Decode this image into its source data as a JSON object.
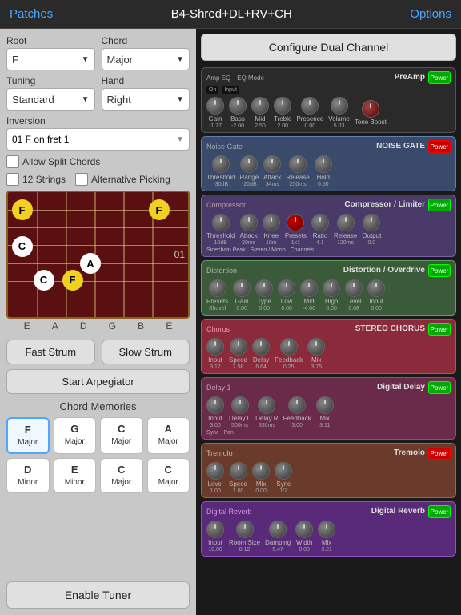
{
  "topbar": {
    "patches": "Patches",
    "title": "B4-Shred+DL+RV+CH",
    "options": "Options"
  },
  "left": {
    "root_label": "Root",
    "root_value": "F",
    "chord_label": "Chord",
    "chord_value": "Major",
    "tuning_label": "Tuning",
    "tuning_value": "Standard",
    "hand_label": "Hand",
    "hand_value": "Right",
    "inversion_label": "Inversion",
    "inversion_value": "01 F on fret 1",
    "allow_split": "Allow Split Chords",
    "twelve_strings": "12 Strings",
    "alt_picking": "Alternative Picking",
    "fret_number": "01",
    "string_labels": [
      "E",
      "A",
      "D",
      "G",
      "B",
      "E"
    ],
    "fast_strum": "Fast Strum",
    "slow_strum": "Slow Strum",
    "start_arp": "Start Arpegiator",
    "chord_memories_label": "Chord Memories",
    "chords": [
      {
        "root": "F",
        "type": "Major",
        "selected": true
      },
      {
        "root": "G",
        "type": "Major",
        "selected": false
      },
      {
        "root": "C",
        "type": "Major",
        "selected": false
      },
      {
        "root": "A",
        "type": "Major",
        "selected": false
      },
      {
        "root": "D",
        "type": "Minor",
        "selected": false
      },
      {
        "root": "E",
        "type": "Minor",
        "selected": false
      },
      {
        "root": "C",
        "type": "Major",
        "selected": false
      },
      {
        "root": "C",
        "type": "Major",
        "selected": false
      }
    ],
    "enable_tuner": "Enable Tuner"
  },
  "right": {
    "configure_btn": "Configure Dual Channel",
    "modules": [
      {
        "id": "preamp",
        "label_left": "Preamp",
        "title": "PreAmp",
        "knobs": [
          {
            "label": "Gain",
            "value": "-1.77"
          },
          {
            "label": "Bass",
            "value": "-2.00"
          },
          {
            "label": "Mid",
            "value": "2.50"
          },
          {
            "label": "Treble",
            "value": "2.00"
          },
          {
            "label": "Presence",
            "value": "0.00"
          },
          {
            "label": "Volume",
            "value": "5.03"
          }
        ],
        "extra": "Tone Boost",
        "sub_labels": [
          "Amp EQ",
          "EQ Mode"
        ],
        "sub_values": [
          "On",
          "Input"
        ],
        "power": "Power"
      },
      {
        "id": "noisegate",
        "label_left": "Noise Gate",
        "title": "NOISE GATE",
        "knobs": [
          {
            "label": "Threshold",
            "value": "-30dB"
          },
          {
            "label": "Range",
            "value": "-20dB"
          },
          {
            "label": "Attack",
            "value": "34ms"
          },
          {
            "label": "Release",
            "value": "250ms"
          },
          {
            "label": "Hold",
            "value": "0.50"
          }
        ],
        "power": "Power"
      },
      {
        "id": "compressor",
        "label_left": "Compressor",
        "title": "Compressor / Limiter",
        "knobs": [
          {
            "label": "Threshold",
            "value": "10dB"
          },
          {
            "label": "Attack",
            "value": "20ms"
          },
          {
            "label": "Knee",
            "value": "10m"
          },
          {
            "label": "Presets",
            "value": "1x1"
          },
          {
            "label": "Ratio",
            "value": "4.1"
          },
          {
            "label": "Release",
            "value": "120ms"
          },
          {
            "label": "Output",
            "value": "0.0"
          }
        ],
        "extra": "Sidechain Peak",
        "power": "Power"
      },
      {
        "id": "distortion",
        "label_left": "Distortion",
        "title": "Distortion / Overdrive",
        "knobs": [
          {
            "label": "Presets",
            "value": "Shovel"
          },
          {
            "label": "Gain",
            "value": "0.00"
          },
          {
            "label": "Type",
            "value": "0.00"
          },
          {
            "label": "Low",
            "value": "0.00"
          },
          {
            "label": "Mid",
            "value": "-4.00"
          },
          {
            "label": "High",
            "value": "0.00"
          },
          {
            "label": "Level",
            "value": "0.08"
          },
          {
            "label": "Input",
            "value": "0.00"
          }
        ],
        "power": "Power"
      },
      {
        "id": "chorus",
        "label_left": "Chorus",
        "title": "STEREO CHORUS",
        "knobs": [
          {
            "label": "Input",
            "value": "3.12"
          },
          {
            "label": "Speed",
            "value": "2.58"
          },
          {
            "label": "Delay",
            "value": "6.64"
          },
          {
            "label": "Feedback",
            "value": "0.25"
          },
          {
            "label": "Mix",
            "value": "3.75"
          }
        ],
        "power": "Power"
      },
      {
        "id": "delay",
        "label_left": "Delay 1",
        "title": "Digital Delay",
        "knobs": [
          {
            "label": "Input",
            "value": "3.00"
          },
          {
            "label": "Delay L",
            "value": "500ms"
          },
          {
            "label": "Delay R",
            "value": "330ms"
          },
          {
            "label": "Feedback",
            "value": "3.00"
          },
          {
            "label": "Mix",
            "value": "3.11"
          }
        ],
        "extra": "Sync / Pan",
        "power": "Power"
      },
      {
        "id": "tremolo",
        "label_left": "Tremolo",
        "title": "Tremolo",
        "knobs": [
          {
            "label": "Level",
            "value": "1.00"
          },
          {
            "label": "Speed",
            "value": "1.00"
          },
          {
            "label": "Mix",
            "value": "0.00"
          },
          {
            "label": "Sync",
            "value": "1/2"
          }
        ],
        "power": "Power"
      },
      {
        "id": "reverb",
        "label_left": "Digital Reverb",
        "title": "Digital Reverb",
        "knobs": [
          {
            "label": "Input",
            "value": "10.00"
          },
          {
            "label": "Room Size",
            "value": "8.12"
          },
          {
            "label": "Damping",
            "value": "5.47"
          },
          {
            "label": "Width",
            "value": "0.00"
          },
          {
            "label": "Mix",
            "value": "3.21"
          }
        ],
        "power": "Power"
      }
    ]
  }
}
